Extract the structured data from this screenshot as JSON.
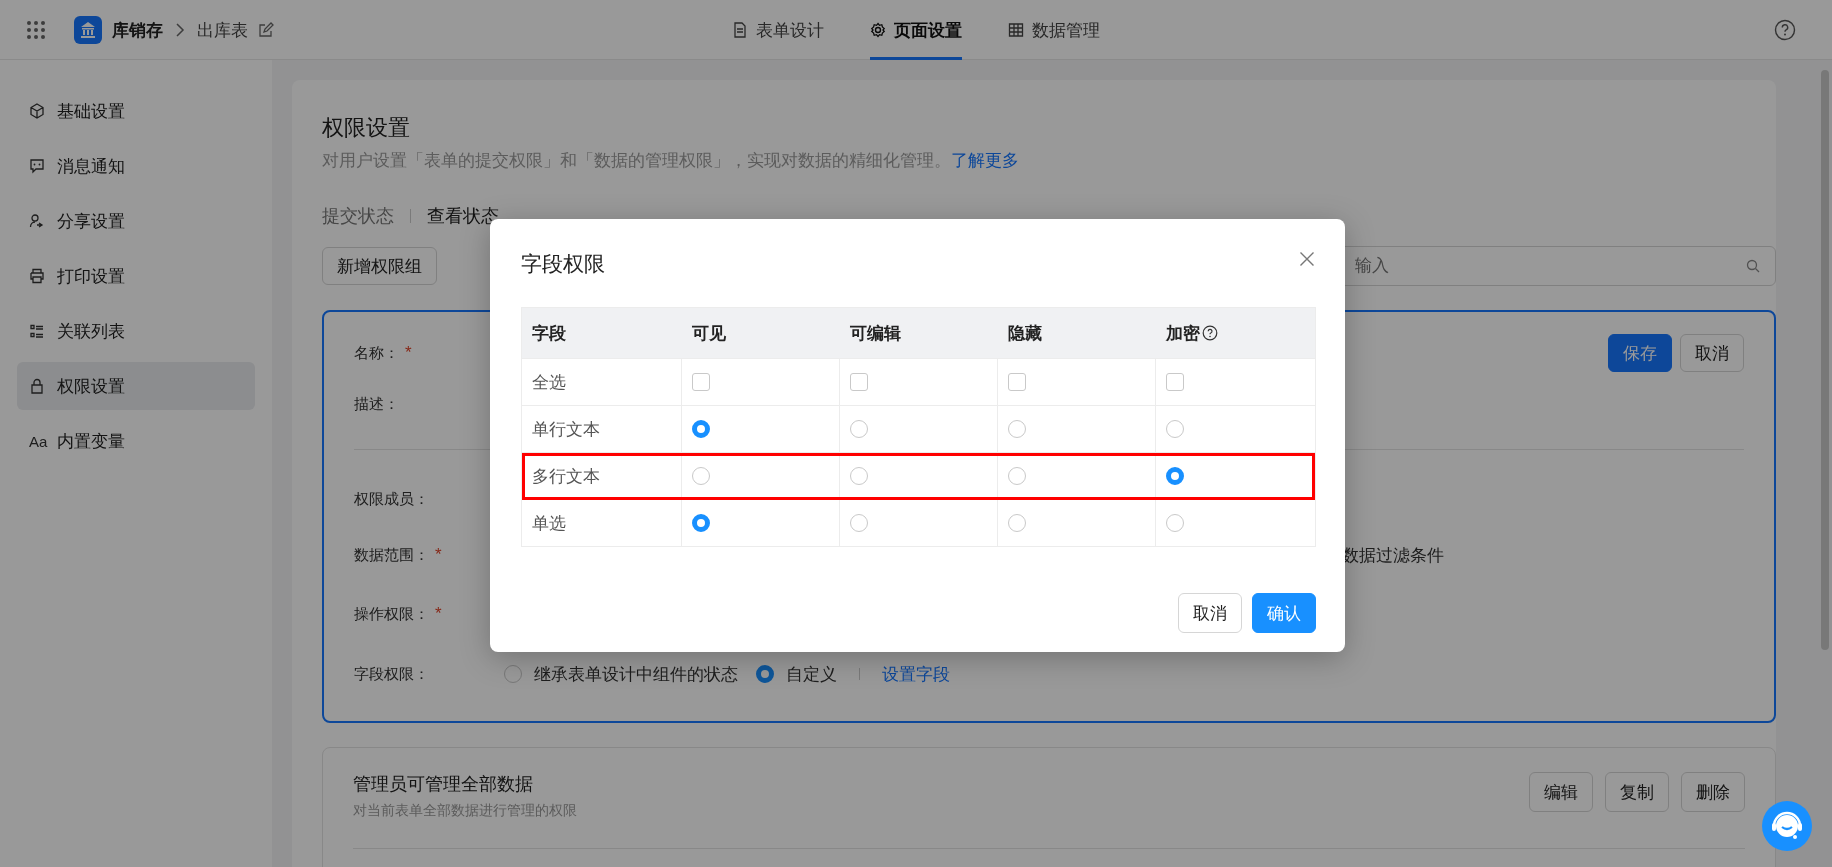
{
  "top_bar": {
    "app_name": "库销存",
    "breadcrumb": "出库表",
    "tabs": [
      {
        "label": "表单设计",
        "selected": false
      },
      {
        "label": "页面设置",
        "selected": true
      },
      {
        "label": "数据管理",
        "selected": false
      }
    ]
  },
  "sidebar": {
    "items": [
      {
        "label": "基础设置",
        "selected": false
      },
      {
        "label": "消息通知",
        "selected": false
      },
      {
        "label": "分享设置",
        "selected": false
      },
      {
        "label": "打印设置",
        "selected": false
      },
      {
        "label": "关联列表",
        "selected": false
      },
      {
        "label": "权限设置",
        "selected": true
      },
      {
        "label": "内置变量",
        "selected": false,
        "glyph": "Aa"
      }
    ]
  },
  "page": {
    "title": "权限设置",
    "description": "对用户设置「表单的提交权限」和「数据的管理权限」，实现对数据的精细化管理。",
    "learn_more": "了解更多",
    "tabs": [
      {
        "label": "提交状态",
        "selected": false
      },
      {
        "label": "查看状态",
        "selected": true
      }
    ],
    "add_button": "新增权限组",
    "search": {
      "placeholder": "输入"
    }
  },
  "group_editor": {
    "save": "保存",
    "cancel": "取消",
    "fields": [
      {
        "label": "名称：",
        "required_mark": "*"
      },
      {
        "label": "描述："
      },
      {
        "label": "权限成员："
      },
      {
        "label": "数据范围：",
        "required_mark": "*",
        "value": "数据过滤条件"
      },
      {
        "label": "操作权限：",
        "required_mark": "*"
      },
      {
        "label": "字段权限：",
        "options": [
          {
            "label": "继承表单设计中组件的状态",
            "selected": false
          },
          {
            "label": "自定义",
            "selected": true
          }
        ],
        "link": "设置字段"
      }
    ]
  },
  "groups": [
    {
      "title": "管理员可管理全部数据",
      "description": "对当前表单全部数据进行管理的权限",
      "actions": [
        "编辑",
        "复制",
        "删除"
      ]
    }
  ],
  "dialog": {
    "title": "字段权限",
    "columns": [
      {
        "label": "字段",
        "help": false
      },
      {
        "label": "可见",
        "help": false
      },
      {
        "label": "可编辑",
        "help": false
      },
      {
        "label": "隐藏",
        "help": false
      },
      {
        "label": "加密",
        "help": true
      }
    ],
    "select_all": {
      "label": "全选",
      "checks": [
        {
          "checked": false
        },
        {
          "checked": false
        },
        {
          "checked": false
        },
        {
          "checked": false
        }
      ]
    },
    "rows": [
      {
        "field": "单行文本",
        "highlighted": false,
        "options": [
          {
            "selected": true
          },
          {
            "selected": false
          },
          {
            "selected": false
          },
          {
            "selected": false
          }
        ]
      },
      {
        "field": "多行文本",
        "highlighted": true,
        "options": [
          {
            "selected": false
          },
          {
            "selected": false
          },
          {
            "selected": false
          },
          {
            "selected": true
          }
        ]
      },
      {
        "field": "单选",
        "highlighted": false,
        "options": [
          {
            "selected": true
          },
          {
            "selected": false
          },
          {
            "selected": false
          },
          {
            "selected": false
          }
        ]
      }
    ],
    "cancel": "取消",
    "confirm": "确认"
  }
}
